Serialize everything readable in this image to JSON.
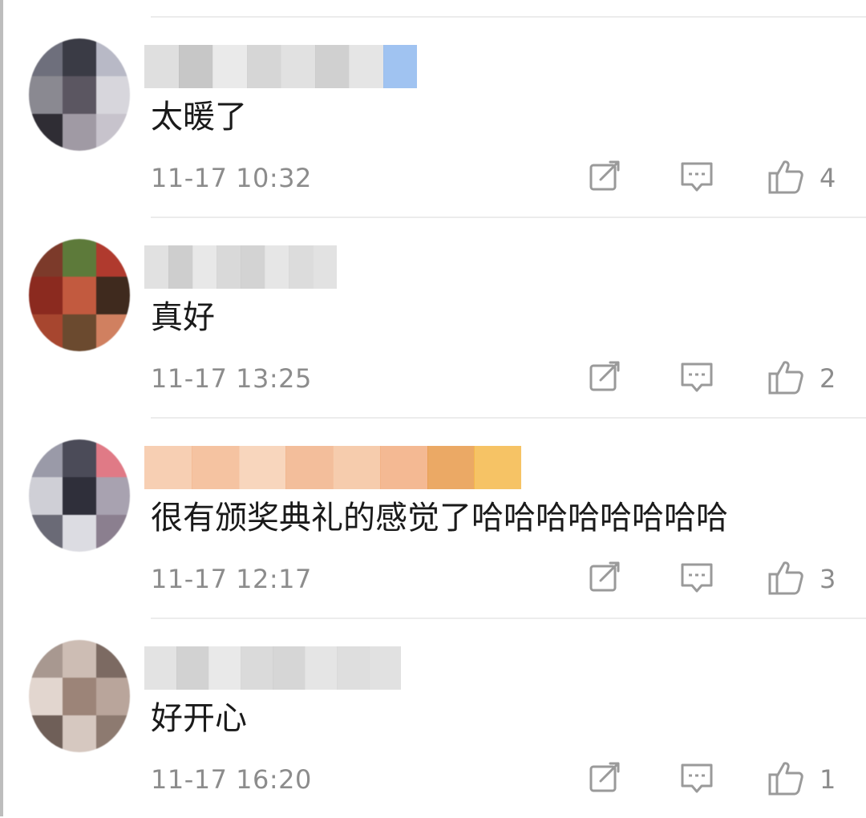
{
  "comments": [
    {
      "text": "太暖了",
      "time": "11-17 10:32",
      "likes": "4",
      "avatar_colors": [
        "#6e6f7c",
        "#3a3b45",
        "#b8b9c6",
        "#8a8991",
        "#5b5661",
        "#d7d6dc",
        "#2f2d34",
        "#a09aa4",
        "#c7c3cc"
      ],
      "name_colors": [
        "#d9d9d9",
        "#bdbdbd",
        "#e6e6e6",
        "#cfcfcf",
        "#dcdcdc",
        "#c8c8c8",
        "#e0e0e0",
        "#8fb8ee"
      ]
    },
    {
      "text": "真好",
      "time": "11-17 13:25",
      "likes": "2",
      "avatar_colors": [
        "#7c3a2a",
        "#5d7a3a",
        "#b03a2e",
        "#8b2a1f",
        "#c25a3f",
        "#3f2a1e",
        "#a7462f",
        "#6b4a2f",
        "#d08060"
      ],
      "name_colors": [
        "#dcdcdc",
        "#c6c6c6",
        "#e4e4e4",
        "#d2d2d2",
        "#cbcbcb",
        "#e2e2e2",
        "#d6d6d6",
        "#dddddd"
      ]
    },
    {
      "text": "很有颁奖典礼的感觉了哈哈哈哈哈哈哈哈",
      "time": "11-17 12:17",
      "likes": "3",
      "avatar_colors": [
        "#9a9aa8",
        "#4b4b58",
        "#e07a86",
        "#cfcfd6",
        "#2f2f3a",
        "#a8a2b0",
        "#6a6a76",
        "#dcdce2",
        "#8b7f8f"
      ],
      "name_colors": [
        "#f6c7a6",
        "#f3b890",
        "#f7cfb2",
        "#f1b38a",
        "#f5c39f",
        "#f2ad80",
        "#e79a4a",
        "#f5b94a"
      ]
    },
    {
      "text": "好开心",
      "time": "11-17 16:20",
      "likes": "1",
      "avatar_colors": [
        "#a89890",
        "#cdbdb4",
        "#7c6a62",
        "#e2d6cf",
        "#9c8478",
        "#b9a59b",
        "#6f5f58",
        "#d6c8c0",
        "#8d7a70"
      ],
      "name_colors": [
        "#dedede",
        "#cacaca",
        "#e5e5e5",
        "#d4d4d4",
        "#cfcfcf",
        "#e1e1e1",
        "#d8d8d8",
        "#dcdcdc"
      ]
    }
  ],
  "icons": {
    "forward": "share-edit-icon",
    "reply": "comment-bubble-icon",
    "like": "thumbs-up-icon"
  },
  "colors": {
    "text": "#1a1a1a",
    "meta": "#8c8c8c",
    "divider": "#ececec"
  }
}
